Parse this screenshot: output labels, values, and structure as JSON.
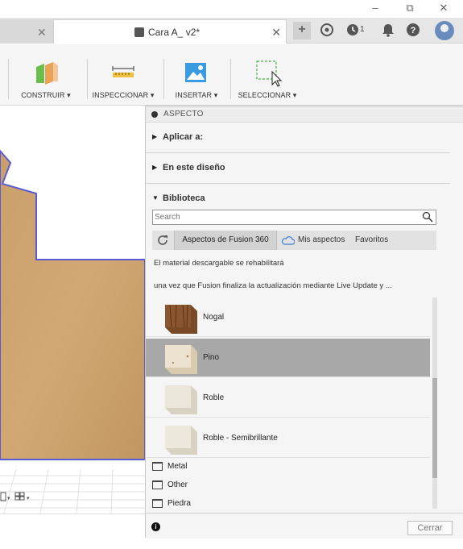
{
  "window": {
    "controls": {
      "minimize": "–",
      "maximize": "⧉",
      "close": "✕"
    }
  },
  "tabs": {
    "left_close": "✕",
    "active_title": "Cara A_ v2*",
    "active_close": "✕",
    "notifications_count": "1"
  },
  "toolbar": {
    "groups": [
      {
        "label": "CONSTRUIR ▾",
        "icon": "construct-icon"
      },
      {
        "label": "INSPECCIONAR ▾",
        "icon": "measure-icon"
      },
      {
        "label": "INSERTAR ▾",
        "icon": "insert-image-icon"
      },
      {
        "label": "SELECCIONAR ▾",
        "icon": "select-icon"
      }
    ]
  },
  "panel": {
    "title": "ASPECTO",
    "sections": {
      "apply": "Aplicar a:",
      "design": "En este diseño",
      "library": "Biblioteca"
    },
    "search": {
      "placeholder": "Search"
    },
    "lib_tabs": {
      "fusion": "Aspectos de Fusion 360",
      "mine": "Mis aspectos",
      "favorites": "Favoritos"
    },
    "messages": {
      "line1": "El material descargable se rehabilitará",
      "line2": "una vez que Fusion finaliza la actualización mediante Live Update y ..."
    },
    "materials": [
      {
        "name": "Nogal",
        "selected": false
      },
      {
        "name": "Pino",
        "selected": true
      },
      {
        "name": "Roble",
        "selected": false
      },
      {
        "name": "Roble - Semibrillante",
        "selected": false
      }
    ],
    "folders": [
      "Metal",
      "Other",
      "Piedra"
    ],
    "footer": {
      "close": "Cerrar"
    }
  },
  "colors": {
    "wood": "#c9a06a",
    "outline": "#5b5bd6",
    "selected_row": "#a8a8a8"
  }
}
